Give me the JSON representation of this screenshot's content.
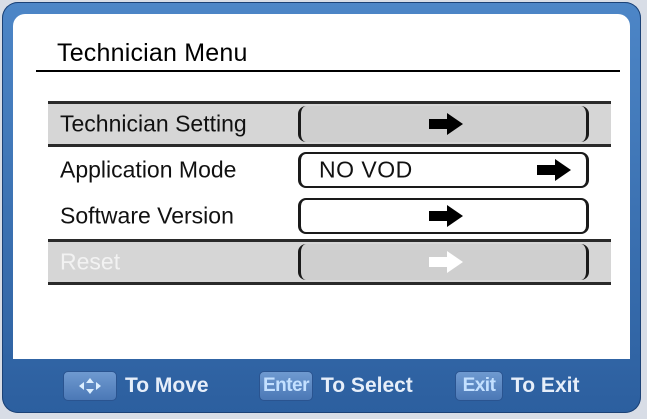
{
  "menu": {
    "title": "Technician Menu",
    "items": [
      {
        "label": "Technician Setting",
        "value": "",
        "arrow": "arrow-right-icon"
      },
      {
        "label": "Application Mode",
        "value": "NO VOD",
        "arrow": "arrow-right-icon"
      },
      {
        "label": "Software Version",
        "value": "",
        "arrow": "arrow-right-icon"
      },
      {
        "label": "Reset",
        "value": "",
        "arrow": "arrow-right-icon"
      }
    ]
  },
  "footer": {
    "move": {
      "key_icon": "navigation-arrows-icon",
      "label": "To Move"
    },
    "select": {
      "key": "Enter",
      "label": "To Select"
    },
    "exit": {
      "key": "Exit",
      "label": "To Exit"
    }
  },
  "colors": {
    "frame": "#3a6fb2",
    "selected_row": "#d6d6d6",
    "panel": "#ffffff",
    "key_text": "#c3e0ff",
    "footer_text": "#e6eef9"
  }
}
